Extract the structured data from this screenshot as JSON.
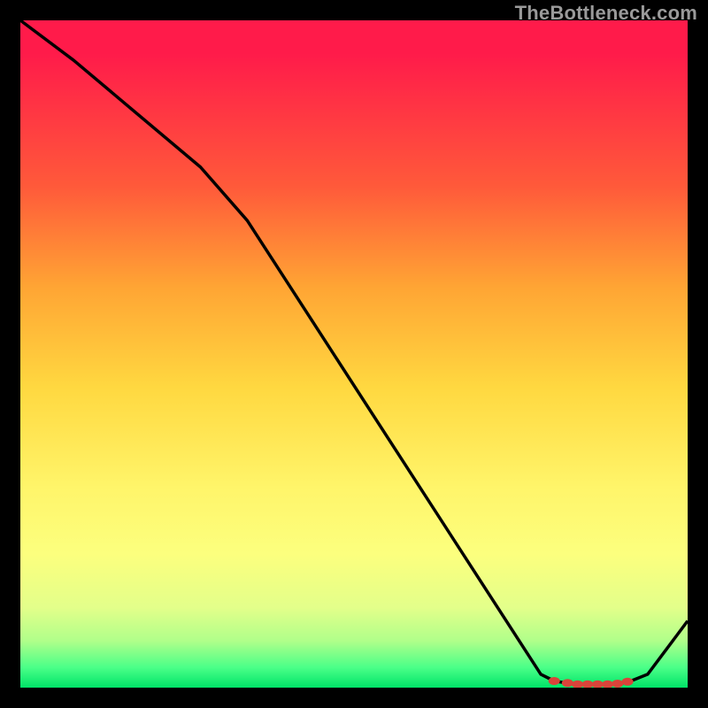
{
  "watermark": "TheBottleneck.com",
  "chart_data": {
    "type": "line",
    "title": "",
    "xlabel": "",
    "ylabel": "",
    "xlim": [
      0,
      100
    ],
    "ylim": [
      0,
      100
    ],
    "series": [
      {
        "name": "bottleneck-curve",
        "x": [
          0,
          8,
          27,
          34,
          78,
          80,
          83,
          85,
          87,
          89,
          91,
          94,
          100
        ],
        "y": [
          100,
          94,
          78,
          70,
          2,
          1,
          0.5,
          0.5,
          0.5,
          0.5,
          0.8,
          2,
          10
        ]
      }
    ],
    "markers": {
      "name": "optimal-range",
      "x": [
        80,
        82,
        83.5,
        85,
        86.5,
        88,
        89.5,
        91
      ],
      "y": [
        1,
        0.7,
        0.5,
        0.5,
        0.5,
        0.5,
        0.6,
        0.9
      ]
    },
    "gradient_stops": [
      {
        "pos": 0,
        "color": "#ff1b4a"
      },
      {
        "pos": 25,
        "color": "#ff5a3a"
      },
      {
        "pos": 55,
        "color": "#ffd840"
      },
      {
        "pos": 80,
        "color": "#fcff7e"
      },
      {
        "pos": 97,
        "color": "#4aff88"
      },
      {
        "pos": 100,
        "color": "#00e468"
      }
    ]
  }
}
